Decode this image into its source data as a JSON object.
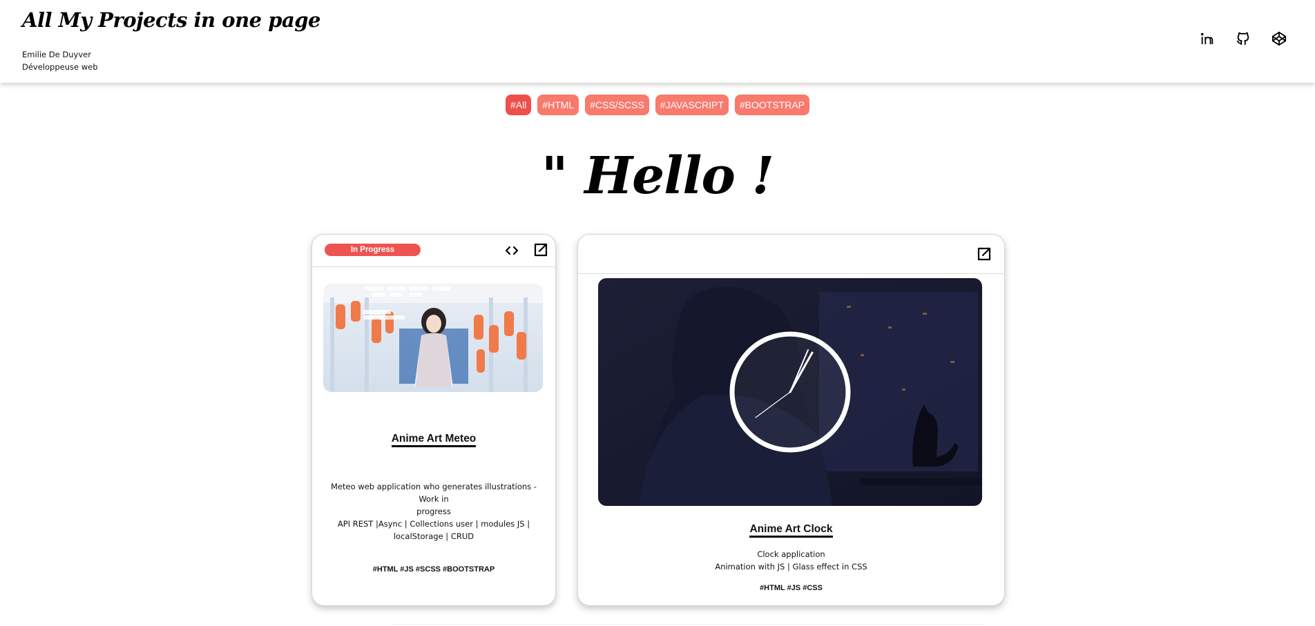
{
  "header": {
    "title": "All My Projects in one page",
    "author_name": "Emilie De Duyver",
    "author_role": "Développeuse web",
    "social": [
      {
        "name": "linkedin-icon"
      },
      {
        "name": "github-icon"
      },
      {
        "name": "codepen-icon"
      }
    ]
  },
  "filters": [
    "#All",
    "#HTML",
    "#CSS/SCSS",
    "#JAVASCRIPT",
    "#BOOTSTRAP"
  ],
  "active_filter": "#All",
  "hello": "\" Hello !",
  "colors": {
    "filter_bg": "#f77a6d",
    "filter_active_bg": "#ef4f4a",
    "badge_bg": "#ef5350"
  },
  "projects": [
    {
      "status": "In Progress",
      "title": "Anime Art Meteo",
      "description_lines": [
        "Meteo web application who generates illustrations - Work in",
        "progress",
        "API REST |Async | Collections user | modules JS |",
        "localStorage | CRUD"
      ],
      "tags": "#HTML #JS #SCSS #BOOTSTRAP",
      "icons": [
        "code-icon",
        "external-link-icon"
      ]
    },
    {
      "title": "Anime Art Clock",
      "description_lines": [
        "Clock application",
        "Animation with JS | Glass effect in CSS"
      ],
      "tags": "#HTML #JS #CSS",
      "icons": [
        "external-link-icon"
      ]
    }
  ]
}
